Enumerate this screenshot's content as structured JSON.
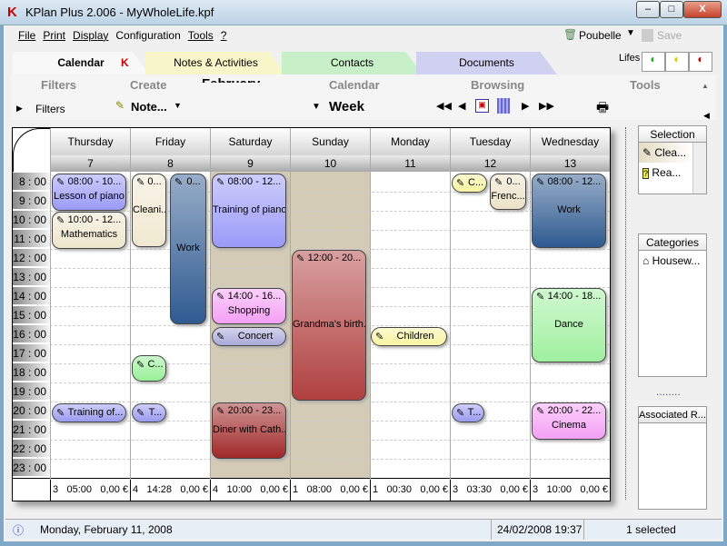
{
  "window": {
    "title": "KPlan Plus 2.006 - MyWholeLife.kpf",
    "minimize": "–",
    "maximize": "□",
    "close": "X"
  },
  "menu": [
    "File",
    "Print",
    "Display",
    "Configuration",
    "Tools",
    "?"
  ],
  "toolbar_right": {
    "trash_label": "Poubelle",
    "save_label": "Save"
  },
  "tabs": [
    {
      "label": "Calendar",
      "color": "#f8f8f8"
    },
    {
      "label": "Notes & Activities",
      "color": "#f8f6c8"
    },
    {
      "label": "Contacts",
      "color": "#c8f0c8"
    },
    {
      "label": "Documents",
      "color": "#d0d0f0"
    }
  ],
  "lifes_label": "Lifes",
  "ribbon": {
    "groups": [
      "Filters",
      "Create",
      "Calendar",
      "Browsing",
      "Tools"
    ],
    "month_partial": "February",
    "filters_label": "Filters",
    "note_button": "Note...",
    "view_select": "Week"
  },
  "days": [
    {
      "name": "Thursday",
      "num": "7"
    },
    {
      "name": "Friday",
      "num": "8"
    },
    {
      "name": "Saturday",
      "num": "9",
      "weekend": true
    },
    {
      "name": "Sunday",
      "num": "10",
      "weekend": true
    },
    {
      "name": "Monday",
      "num": "11"
    },
    {
      "name": "Tuesday",
      "num": "12"
    },
    {
      "name": "Wednesday",
      "num": "13"
    }
  ],
  "hours": [
    "8 : 00",
    "9 : 00",
    "10 : 00",
    "11 : 00",
    "12 : 00",
    "13 : 00",
    "14 : 00",
    "15 : 00",
    "16 : 00",
    "17 : 00",
    "18 : 00",
    "19 : 00",
    "20 : 00",
    "21 : 00",
    "22 : 00",
    "23 : 00"
  ],
  "events": [
    {
      "day": "Thursday",
      "time": "08:00 - 10...",
      "label": "Lesson of piano",
      "color": "#9a9af8"
    },
    {
      "day": "Thursday",
      "time": "10:00 - 12...",
      "label": "Mathematics",
      "color": "#eee6cc"
    },
    {
      "day": "Thursday",
      "time": "",
      "label": "Training of...",
      "color": "#9a9af0"
    },
    {
      "day": "Friday",
      "time": "0...",
      "label": "Cleani...",
      "color": "#f0e8d0"
    },
    {
      "day": "Friday",
      "time": "0...",
      "label": "Work",
      "color": "#2f5a90"
    },
    {
      "day": "Friday",
      "time": "",
      "label": "C...",
      "color": "#98f098"
    },
    {
      "day": "Friday",
      "time": "",
      "label": "T...",
      "color": "#9a9af0"
    },
    {
      "day": "Saturday",
      "time": "08:00 - 12...",
      "label": "Training of piano",
      "color": "#9a9af8"
    },
    {
      "day": "Saturday",
      "time": "14:00 - 16...",
      "label": "Shopping",
      "color": "#f4a0f4"
    },
    {
      "day": "Saturday",
      "time": "",
      "label": "Concert",
      "color": "#a8a8d8"
    },
    {
      "day": "Saturday",
      "time": "20:00 - 23...",
      "label": "Diner with Cath...",
      "color": "#a02828"
    },
    {
      "day": "Sunday",
      "time": "12:00 - 20...",
      "label": "Grandma's birth...",
      "color": "#b04040"
    },
    {
      "day": "Monday",
      "time": "",
      "label": "Children",
      "color": "#f8f4a0"
    },
    {
      "day": "Tuesday",
      "time": "",
      "label": "C...",
      "color": "#f8f4a0"
    },
    {
      "day": "Tuesday",
      "time": "0...",
      "label": "Frenc...",
      "color": "#ece2c8"
    },
    {
      "day": "Tuesday",
      "time": "",
      "label": "T...",
      "color": "#9a9af0"
    },
    {
      "day": "Wednesday",
      "time": "08:00 - 12...",
      "label": "Work",
      "color": "#2f5a90"
    },
    {
      "day": "Wednesday",
      "time": "14:00 - 18...",
      "label": "Dance",
      "color": "#a0f0a0"
    },
    {
      "day": "Wednesday",
      "time": "20:00 - 22...",
      "label": "Cinema",
      "color": "#f4a0f4"
    }
  ],
  "footer": [
    {
      "count": "3",
      "duration": "05:00",
      "cost": "0,00 €"
    },
    {
      "count": "4",
      "duration": "14:28",
      "cost": "0,00 €"
    },
    {
      "count": "4",
      "duration": "10:00",
      "cost": "0,00 €"
    },
    {
      "count": "1",
      "duration": "08:00",
      "cost": "0,00 €"
    },
    {
      "count": "1",
      "duration": "00:30",
      "cost": "0,00 €"
    },
    {
      "count": "3",
      "duration": "03:30",
      "cost": "0,00 €"
    },
    {
      "count": "3",
      "duration": "10:00",
      "cost": "0,00 €"
    }
  ],
  "side": {
    "selection_title": "Selection",
    "selection_items": [
      "Clea...",
      "Rea..."
    ],
    "categories_title": "Categories",
    "categories_items": [
      "Housew..."
    ],
    "separator": "........",
    "associated_title": "Associated R..."
  },
  "status": {
    "date": "Monday, February 11, 2008",
    "datetime": "24/02/2008 19:37",
    "selected": "1 selected"
  },
  "colors": {
    "weekend_bg": "#d4cbb6"
  }
}
